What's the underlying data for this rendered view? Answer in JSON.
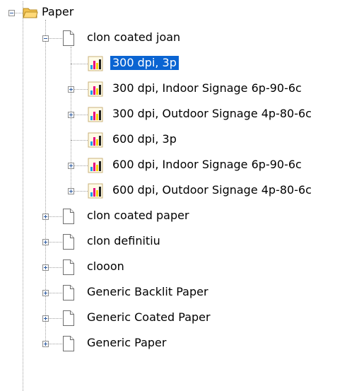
{
  "tree": {
    "root": {
      "label": "Paper",
      "icon": "folder-open-icon"
    },
    "children": [
      {
        "label": "clon coated joan",
        "expanded": true,
        "icon": "document-icon",
        "children": [
          {
            "label": "300 dpi, 3p",
            "selected": true,
            "icon": "print-settings-icon"
          },
          {
            "label": "300 dpi, Indoor Signage 6p-90-6c",
            "icon": "print-settings-icon"
          },
          {
            "label": "300 dpi, Outdoor Signage 4p-80-6c",
            "icon": "print-settings-icon"
          },
          {
            "label": "600 dpi, 3p",
            "icon": "print-settings-icon"
          },
          {
            "label": "600 dpi, Indoor Signage 6p-90-6c",
            "icon": "print-settings-icon"
          },
          {
            "label": "600 dpi, Outdoor Signage 4p-80-6c",
            "icon": "print-settings-icon"
          }
        ]
      },
      {
        "label": "clon coated paper",
        "icon": "document-icon"
      },
      {
        "label": "clon definitiu",
        "icon": "document-icon"
      },
      {
        "label": "clooon",
        "icon": "document-icon"
      },
      {
        "label": "Generic Backlit Paper",
        "icon": "document-icon"
      },
      {
        "label": "Generic Coated Paper",
        "icon": "document-icon"
      },
      {
        "label": "Generic Paper",
        "icon": "document-icon"
      }
    ]
  },
  "colors": {
    "selection": "#0a64d2",
    "folder": "#f2c14e",
    "expander": "#2c5aa0",
    "ink_cyan": "#1ea0e6",
    "ink_magenta": "#e6007e",
    "ink_yellow": "#ffd200",
    "ink_black": "#222222"
  }
}
